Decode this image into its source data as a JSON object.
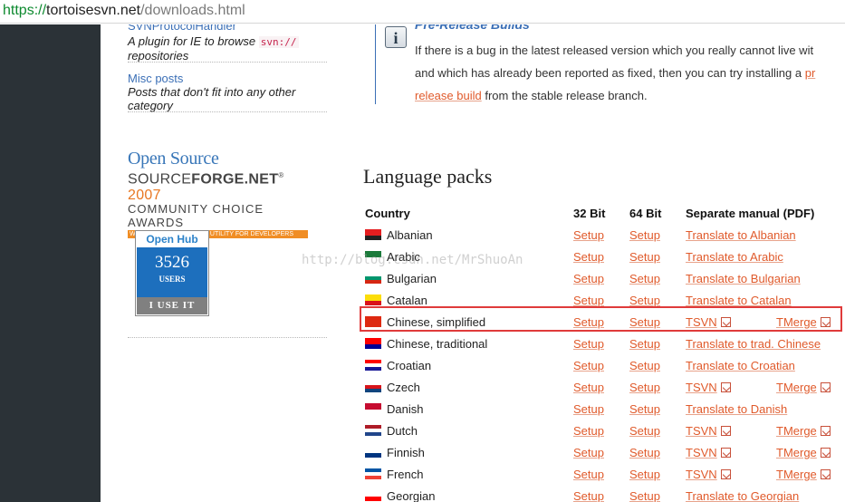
{
  "browser": {
    "url_scheme": "https://",
    "url_host": "tortoisesvn.net",
    "url_path": "/downloads.html"
  },
  "sidebar": {
    "cut_link": "SVNProtocolHandler",
    "cut_desc_1": "A plugin for IE to browse",
    "cut_desc_code": "svn://",
    "cut_desc_2": "repositories",
    "misc_link": "Misc posts",
    "misc_desc_1": "Posts that don't fit into any other",
    "misc_desc_2": "category",
    "open_source": "Open Source",
    "sf_source": "SOURCE",
    "sf_forge": "FORGE.NET",
    "sf_reg": "®",
    "sf_year": "2007",
    "sf_line2": "COMMUNITY CHOICE AWARDS",
    "sf_line3": "WINNER: BEST PROJECT/ UTILITY FOR DEVELOPERS",
    "openhub_title": "Open Hub",
    "openhub_count": "3526",
    "openhub_users": "USERS",
    "openhub_footer": "I USE IT"
  },
  "info": {
    "title": "Pre-Release Builds",
    "line1": "If there is a bug in the latest released version which you really cannot live wit",
    "line2": "and which has already been reported as fixed, then you can try installing a",
    "line2_link": "pr",
    "line3_link": "release build",
    "line3": "from the stable release branch."
  },
  "language_packs": {
    "heading": "Language packs",
    "headers": [
      "Country",
      "32 Bit",
      "64 Bit",
      "Separate manual (PDF)"
    ],
    "rows": [
      {
        "country": "Albanian",
        "b32": "Setup",
        "b64": "Setup",
        "manual": "Translate to Albanian",
        "flag": [
          "#e41e20",
          "#222222"
        ]
      },
      {
        "country": "Arabic",
        "b32": "Setup",
        "b64": "Setup",
        "manual": "Translate to Arabic",
        "flag": [
          "#1a7a3a",
          "#ffffff"
        ]
      },
      {
        "country": "Bulgarian",
        "b32": "Setup",
        "b64": "Setup",
        "manual": "Translate to Bulgarian",
        "flag": [
          "#ffffff",
          "#00966e",
          "#d62612"
        ]
      },
      {
        "country": "Catalan",
        "b32": "Setup",
        "b64": "Setup",
        "manual": "Translate to Catalan",
        "flag": [
          "#fcdd09",
          "#da121a"
        ]
      },
      {
        "country": "Chinese, simplified",
        "b32": "Setup",
        "b64": "Setup",
        "tsvn": "TSVN",
        "tmerge": "TMerge",
        "flag": [
          "#de2910",
          "#de2910"
        ]
      },
      {
        "country": "Chinese, traditional",
        "b32": "Setup",
        "b64": "Setup",
        "manual": "Translate to trad. Chinese",
        "flag": [
          "#fe0000",
          "#000095"
        ]
      },
      {
        "country": "Croatian",
        "b32": "Setup",
        "b64": "Setup",
        "manual": "Translate to Croatian",
        "flag": [
          "#ff0000",
          "#ffffff",
          "#171796"
        ]
      },
      {
        "country": "Czech",
        "b32": "Setup",
        "b64": "Setup",
        "tsvn": "TSVN",
        "tmerge": "TMerge",
        "flag": [
          "#ffffff",
          "#d7141a",
          "#11457e"
        ]
      },
      {
        "country": "Danish",
        "b32": "Setup",
        "b64": "Setup",
        "manual": "Translate to Danish",
        "flag": [
          "#c60c30",
          "#ffffff"
        ]
      },
      {
        "country": "Dutch",
        "b32": "Setup",
        "b64": "Setup",
        "tsvn": "TSVN",
        "tmerge": "TMerge",
        "flag": [
          "#ae1c28",
          "#ffffff",
          "#21468b"
        ]
      },
      {
        "country": "Finnish",
        "b32": "Setup",
        "b64": "Setup",
        "tsvn": "TSVN",
        "tmerge": "TMerge",
        "flag": [
          "#ffffff",
          "#003580"
        ]
      },
      {
        "country": "French",
        "b32": "Setup",
        "b64": "Setup",
        "tsvn": "TSVN",
        "tmerge": "TMerge",
        "flag": [
          "#0055a4",
          "#ffffff",
          "#ef4135"
        ]
      },
      {
        "country": "Georgian",
        "b32": "Setup",
        "b64": "Setup",
        "manual": "Translate to Georgian",
        "flag": [
          "#ffffff",
          "#ff0000"
        ]
      }
    ]
  },
  "watermark": "http://blog.csdn.net/MrShuoAn",
  "highlight_color": "#e03b3b",
  "link_color": "#e05a2b"
}
